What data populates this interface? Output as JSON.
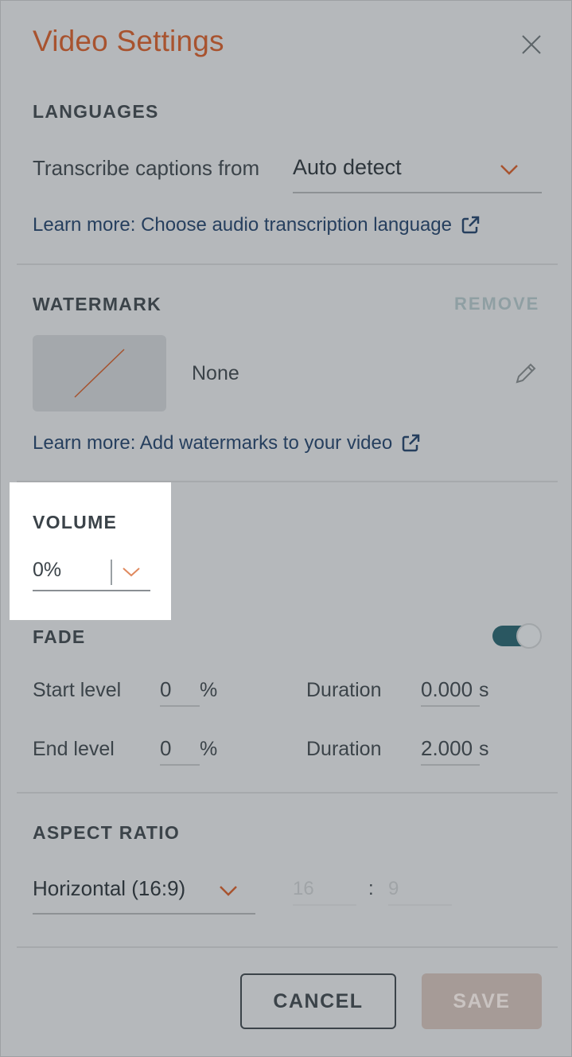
{
  "dialog": {
    "title": "Video Settings"
  },
  "languages": {
    "section_label": "LANGUAGES",
    "transcribe_label": "Transcribe captions from",
    "transcribe_value": "Auto detect",
    "learn_more": "Learn more: Choose audio transcription language"
  },
  "watermark": {
    "section_label": "WATERMARK",
    "remove_label": "REMOVE",
    "current": "None",
    "learn_more": "Learn more: Add watermarks to your video"
  },
  "volume": {
    "section_label": "VOLUME",
    "value": "0%"
  },
  "fade": {
    "section_label": "FADE",
    "enabled": true,
    "start_level_label": "Start level",
    "start_level_value": "0",
    "end_level_label": "End level",
    "end_level_value": "0",
    "percent_unit": "%",
    "duration_label": "Duration",
    "start_duration_value": "0.000",
    "end_duration_value": "2.000",
    "seconds_unit": "s"
  },
  "aspect_ratio": {
    "section_label": "ASPECT RATIO",
    "value": "Horizontal (16:9)",
    "width_placeholder": "16",
    "separator": ":",
    "height_placeholder": "9"
  },
  "footer": {
    "cancel_label": "CANCEL",
    "save_label": "SAVE"
  },
  "colors": {
    "title": "#a8532f",
    "accent_chevron": "#a8532f",
    "toggle_on": "#2a5761",
    "link": "#263f5e"
  }
}
